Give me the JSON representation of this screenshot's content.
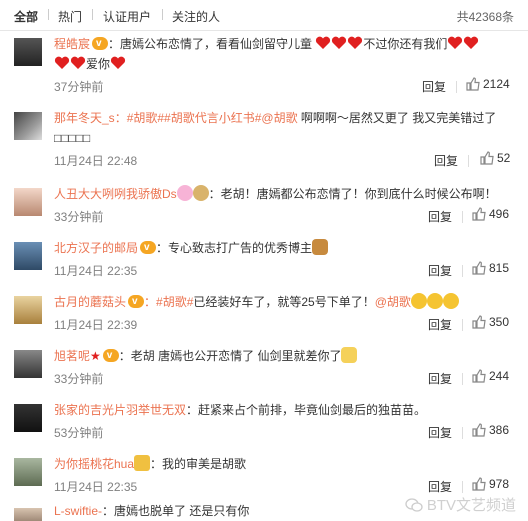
{
  "tabs": {
    "all": "全部",
    "hot": "热门",
    "verified": "认证用户",
    "following": "关注的人"
  },
  "total": "共42368条",
  "actions": {
    "reply": "回复"
  },
  "watermark": "BTV文艺频道",
  "comments": [
    {
      "user": "程皓宸",
      "text": "：唐嫣公布恋情了，看看仙剑留守儿童",
      "text2": "不过你还有我们",
      "text3": "爱你",
      "time": "37分钟前",
      "likes": "2124"
    },
    {
      "user": "那年冬天_s",
      "tags": "：#胡歌##胡歌代言小红书#@胡歌",
      "text": " 啊啊啊～居然又更了 我又完美错过了 □□□□□",
      "time": "11月24日 22:48",
      "likes": "52"
    },
    {
      "user": "人丑大大咧咧我骄傲Ds",
      "text": "：老胡！唐嫣都公布恋情了！你到底什么时候公布啊！",
      "time": "33分钟前",
      "likes": "496"
    },
    {
      "user": "北方汉子的邮局",
      "text": "：专心致志打广告的优秀博主",
      "time": "11月24日 22:35",
      "likes": "815"
    },
    {
      "user": "古月的蘑菇头",
      "tags": "：#胡歌#",
      "text": "已经装好车了，就等25号下单了！",
      "mention": "@胡歌",
      "time": "11月24日 22:39",
      "likes": "350"
    },
    {
      "user": "旭茗呢",
      "text": "：老胡 唐嫣也公开恋情了 仙剑里就差你了",
      "time": "33分钟前",
      "likes": "244"
    },
    {
      "user": "张家的吉光片羽举世无双",
      "text": "：赶紧来占个前排，毕竟仙剑最后的独苗苗。",
      "time": "53分钟前",
      "likes": "386"
    },
    {
      "user": "为你摇桃花hua",
      "text": "：我的审美是胡歌",
      "time": "11月24日 22:35",
      "likes": "978"
    },
    {
      "user": "L-swiftie-",
      "text": "：唐嫣也脱单了    还是只有你"
    }
  ]
}
